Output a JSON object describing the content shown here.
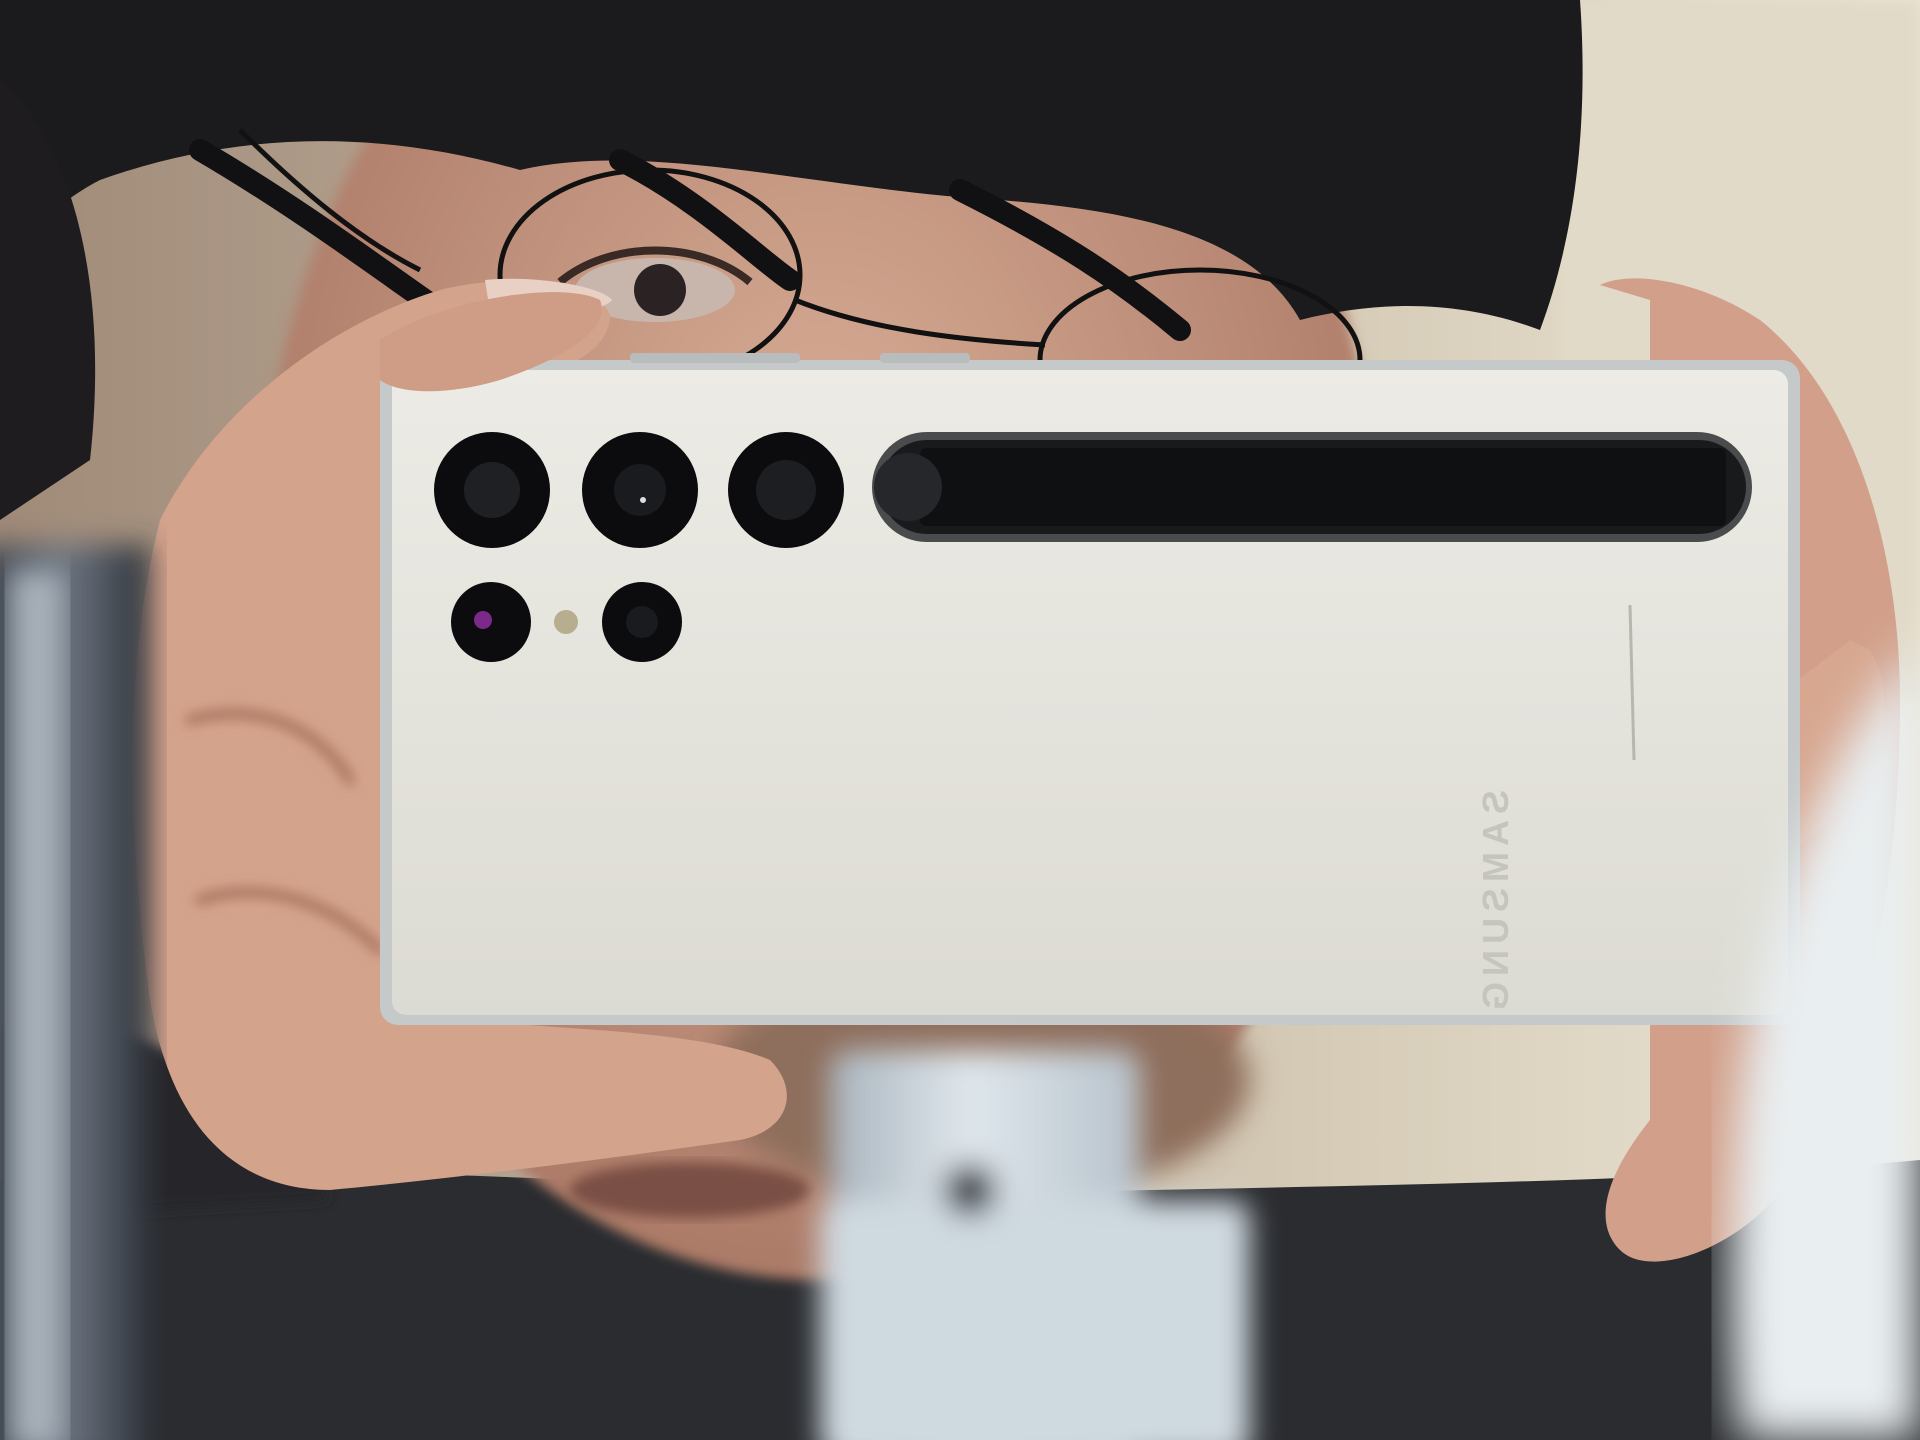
{
  "photo": {
    "subject": "mirror-selfie-with-phone",
    "phone": {
      "brand_text": "SAMSUNG",
      "body_color": "#e6e5de",
      "frame_color": "#cfd2d3",
      "lens_color": "#0c0c0e",
      "pen_color": "#141416"
    },
    "colors": {
      "wall": "#d9d1bd",
      "hair": "#1b1a1c",
      "skin": "#d7a991",
      "skin_shadow": "#b7846d",
      "sweater": "#2a2c30",
      "foreground_bottle": "#c8d4dc",
      "foreground_box": "#9aa3ad",
      "mirror_rim": "#e9eef0"
    },
    "icons": [
      "camera-lens-icon",
      "flash-icon",
      "s-pen-icon"
    ]
  }
}
